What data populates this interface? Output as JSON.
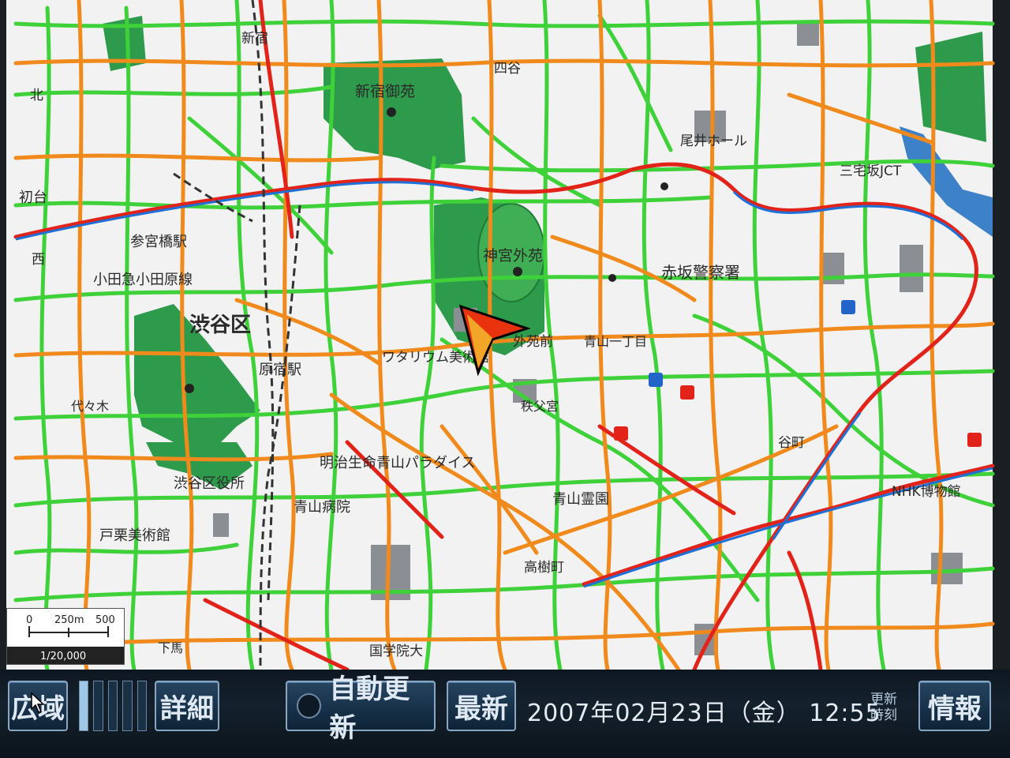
{
  "colors": {
    "traffic_free": "#3fd13a",
    "traffic_slow": "#f08a1c",
    "traffic_jam": "#e2231a",
    "park": "#2e9a4b",
    "expressway": "#1e6fd6",
    "background": "#f1f1f1"
  },
  "map": {
    "district_label": "渋谷区",
    "labels": {
      "shinjuku_gyoen": "新宿御苑",
      "jingu_gaien": "神宮外苑",
      "akasaka_police": "赤坂警察署",
      "sangubashi": "参宮橋駅",
      "odakyu": "小田急小田原線",
      "harajuku": "原宿駅",
      "watari_museum": "ワタリウム美術館",
      "meiji_seimei": "明治生命青山パラダイス",
      "aoyama_hospital": "青山病院",
      "shibuya_office": "渋谷区役所",
      "togakushi_museum": "戸栗美術館",
      "aoyama_cemetery": "青山霊園",
      "hatsudai": "初台",
      "shinjuku": "新宿",
      "yotsuya": "四谷",
      "kioi": "尾井ホール",
      "miyake": "三宅坂JCT",
      "gaien_mae": "外苑前",
      "kokugakuin": "国学院大",
      "takagi": "高樹町",
      "nhk_museum": "NHK博物館",
      "chichibu": "秩父宮",
      "yoyogi": "代々木",
      "aoyama_itchome": "青山一丁目",
      "setagaya": "下馬",
      "tanimachi": "谷町",
      "kita": "北",
      "nishi": "西"
    },
    "scale": {
      "ticks": [
        "0",
        "250m",
        "500"
      ],
      "ratio": "1/20,000"
    }
  },
  "toolbar": {
    "wide_label": "広域",
    "detail_label": "詳細",
    "auto_update_label": "自動更新",
    "latest_label": "最新",
    "datetime": "2007年02月23日（金） 12:55",
    "update_time_label": "更新時刻",
    "info_label": "情報",
    "zoom_level_of_5": 1
  },
  "icons": {
    "vehicle": "vehicle-arrow-icon",
    "radio": "radio-indicator-icon"
  }
}
